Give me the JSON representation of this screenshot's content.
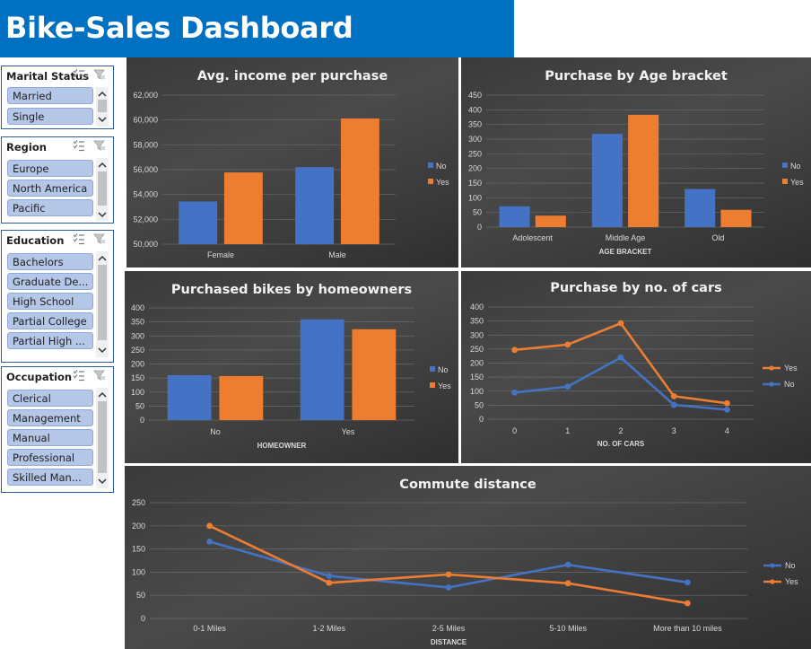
{
  "dashboard": {
    "title": "Bike-Sales Dashboard"
  },
  "slicers": [
    {
      "id": "marital",
      "title": "Marital Status",
      "items": [
        "Married",
        "Single"
      ]
    },
    {
      "id": "region",
      "title": "Region",
      "items": [
        "Europe",
        "North America",
        "Pacific"
      ]
    },
    {
      "id": "education",
      "title": "Education",
      "items": [
        "Bachelors",
        "Graduate De...",
        "High School",
        "Partial College",
        "Partial High ..."
      ]
    },
    {
      "id": "occupation",
      "title": "Occupation",
      "items": [
        "Clerical",
        "Management",
        "Manual",
        "Professional",
        "Skilled Man..."
      ]
    }
  ],
  "colors": {
    "no": "#4472c4",
    "yes": "#ed7d31",
    "accent": "#0070c0",
    "slicer_item": "#b4c7e7"
  },
  "chart_data": [
    {
      "id": "income",
      "type": "bar",
      "title": "Avg. income per purchase",
      "categories": [
        "Female",
        "Male"
      ],
      "series": [
        {
          "name": "No",
          "values": [
            53440,
            56208
          ]
        },
        {
          "name": "Yes",
          "values": [
            55774,
            60124
          ]
        }
      ],
      "ylim": [
        50000,
        62000
      ],
      "yticks": [
        50000,
        52000,
        54000,
        56000,
        58000,
        60000,
        62000
      ],
      "yticklabels": [
        "50,000",
        "52,000",
        "54,000",
        "56,000",
        "58,000",
        "60,000",
        "62,000"
      ],
      "xlabel": "",
      "ylabel": "",
      "legend": "right",
      "grid": true
    },
    {
      "id": "age",
      "type": "bar",
      "title": "Purchase by Age bracket",
      "categories": [
        "Adolescent",
        "Middle Age",
        "Old"
      ],
      "series": [
        {
          "name": "No",
          "values": [
            71,
            318,
            130
          ]
        },
        {
          "name": "Yes",
          "values": [
            39,
            383,
            59
          ]
        }
      ],
      "ylim": [
        0,
        450
      ],
      "yticks": [
        0,
        50,
        100,
        150,
        200,
        250,
        300,
        350,
        400,
        450
      ],
      "xlabel": "AGE BRACKET",
      "ylabel": "",
      "legend": "right",
      "grid": true
    },
    {
      "id": "homeowner",
      "type": "bar",
      "title": "Purchased bikes by homeowners",
      "categories": [
        "No",
        "Yes"
      ],
      "series": [
        {
          "name": "No",
          "values": [
            160,
            359
          ]
        },
        {
          "name": "Yes",
          "values": [
            157,
            324
          ]
        }
      ],
      "ylim": [
        0,
        400
      ],
      "yticks": [
        0,
        50,
        100,
        150,
        200,
        250,
        300,
        350,
        400
      ],
      "xlabel": "HOMEOWNER",
      "ylabel": "",
      "legend": "right",
      "grid": true
    },
    {
      "id": "cars",
      "type": "line",
      "title": "Purchase by no. of cars",
      "categories": [
        "0",
        "1",
        "2",
        "3",
        "4"
      ],
      "series": [
        {
          "name": "Yes",
          "values": [
            247,
            266,
            342,
            82,
            57
          ]
        },
        {
          "name": "No",
          "values": [
            95,
            116,
            220,
            51,
            34
          ]
        }
      ],
      "ylim": [
        0,
        400
      ],
      "yticks": [
        0,
        50,
        100,
        150,
        200,
        250,
        300,
        350,
        400
      ],
      "xlabel": "NO. OF CARS",
      "ylabel": "",
      "legend": "right",
      "grid": true
    },
    {
      "id": "commute",
      "type": "line",
      "title": "Commute distance",
      "categories": [
        "0-1 Miles",
        "1-2 Miles",
        "2-5 Miles",
        "5-10 Miles",
        "More than 10 miles"
      ],
      "series": [
        {
          "name": "No",
          "values": [
            166,
            92,
            67,
            116,
            78
          ]
        },
        {
          "name": "Yes",
          "values": [
            200,
            77,
            95,
            76,
            33
          ]
        }
      ],
      "ylim": [
        0,
        250
      ],
      "yticks": [
        0,
        50,
        100,
        150,
        200,
        250
      ],
      "xlabel": "DISTANCE",
      "ylabel": "",
      "legend": "right",
      "grid": true
    }
  ]
}
